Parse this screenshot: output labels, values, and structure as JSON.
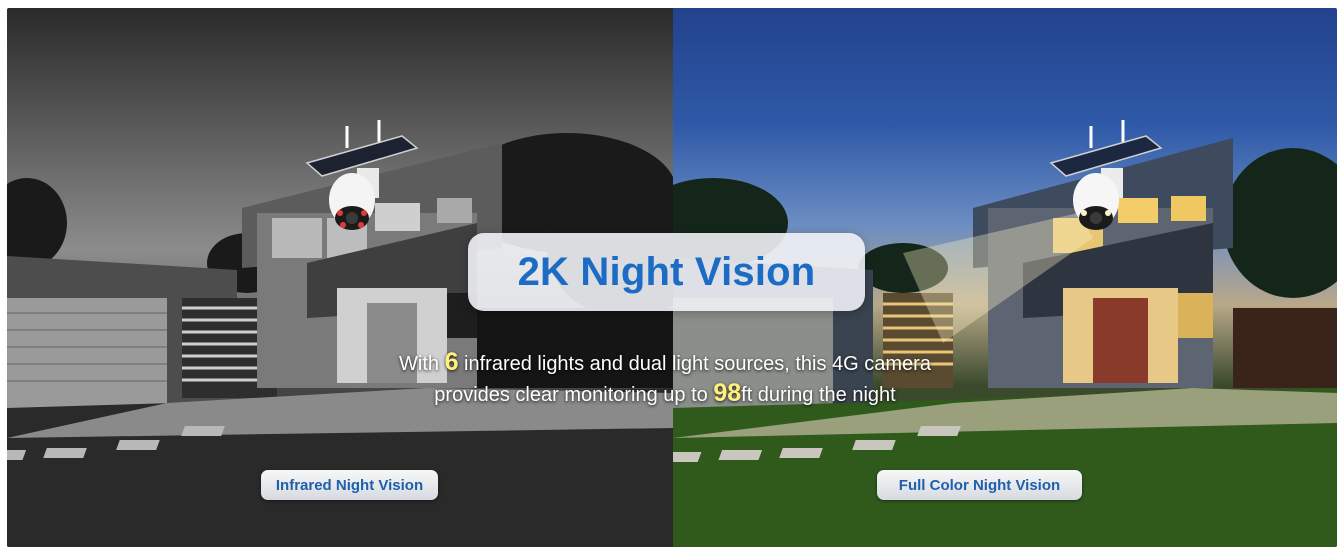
{
  "headline": "2K Night Vision",
  "description": {
    "line1_before": "With ",
    "lights_count": "6",
    "line1_after": " infrared lights and dual light sources, this 4G camera",
    "line2_before": "provides clear monitoring up to ",
    "range_value": "98",
    "line2_after": "ft during the night"
  },
  "labels": {
    "left": "Infrared Night Vision",
    "right": "Full Color Night Vision"
  },
  "colors": {
    "headline": "#1c6cc6",
    "highlight": "#fff27a",
    "badge_text": "#1f5fae"
  }
}
